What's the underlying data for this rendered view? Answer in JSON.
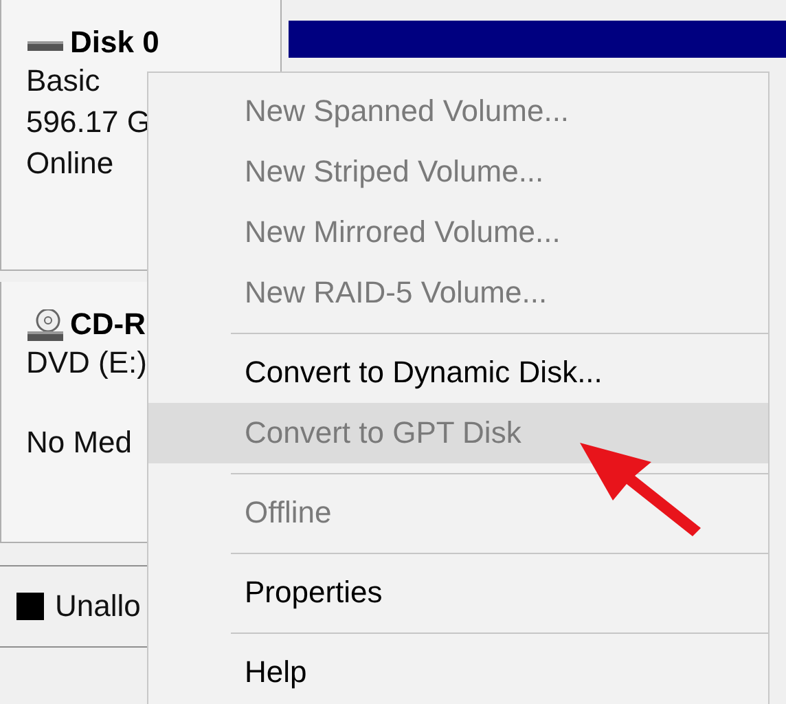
{
  "disks": [
    {
      "kind": "disk",
      "name": "Disk 0",
      "lines": [
        "Basic",
        "596.17 G",
        "Online"
      ]
    },
    {
      "kind": "cdrom",
      "name": "CD-R",
      "lines": [
        "DVD (E:)",
        "No Med"
      ]
    }
  ],
  "legend": [
    {
      "label": "Unallo",
      "color": "#000000"
    }
  ],
  "context_menu": {
    "groups": [
      [
        {
          "label": "New Spanned Volume...",
          "disabled": true,
          "selected": false
        },
        {
          "label": "New Striped Volume...",
          "disabled": true,
          "selected": false
        },
        {
          "label": "New Mirrored Volume...",
          "disabled": true,
          "selected": false
        },
        {
          "label": "New RAID-5 Volume...",
          "disabled": true,
          "selected": false
        }
      ],
      [
        {
          "label": "Convert to Dynamic Disk...",
          "disabled": false,
          "selected": false
        },
        {
          "label": "Convert to GPT Disk",
          "disabled": true,
          "selected": true
        }
      ],
      [
        {
          "label": "Offline",
          "disabled": true,
          "selected": false
        }
      ],
      [
        {
          "label": "Properties",
          "disabled": false,
          "selected": false
        }
      ],
      [
        {
          "label": "Help",
          "disabled": false,
          "selected": false
        }
      ]
    ]
  }
}
